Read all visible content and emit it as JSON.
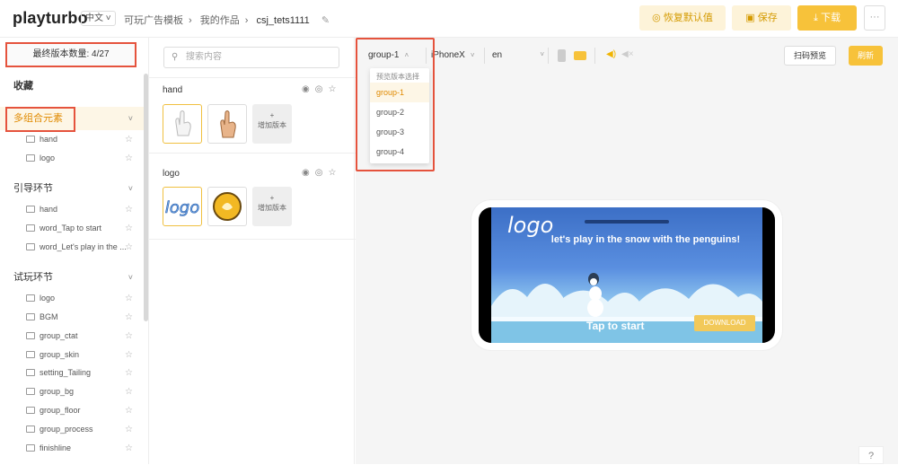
{
  "header": {
    "logo": "playturbo",
    "lang": "中文",
    "breadcrumb": [
      "可玩广告模板",
      "我的作品",
      "csj_tets1111"
    ],
    "restore_label": "恢复默认值",
    "save_label": "保存",
    "download_label": "下载",
    "more_label": "···"
  },
  "sidebar": {
    "version_count": "最终版本数量: 4/27",
    "favorites": "收藏",
    "sections": [
      {
        "title": "多组合元素",
        "items": [
          "hand",
          "logo"
        ]
      },
      {
        "title": "引导环节",
        "items": [
          "hand",
          "word_Tap to start",
          "word_Let's play in the ..."
        ]
      },
      {
        "title": "试玩环节",
        "items": [
          "logo",
          "BGM",
          "group_ctat",
          "group_skin",
          "setting_Tailing",
          "group_bg",
          "group_floor",
          "group_process",
          "finishline"
        ]
      }
    ]
  },
  "assets": {
    "search_placeholder": "搜索内容",
    "groups": [
      {
        "name": "hand",
        "add_label": "增加版本"
      },
      {
        "name": "logo",
        "add_label": "增加版本"
      }
    ]
  },
  "preview": {
    "group_select": "group-1",
    "device_select": "iPhoneX",
    "lang_select": "en",
    "scan_label": "扫码预览",
    "refresh_label": "刷新",
    "dropdown": {
      "header": "预览版本选择",
      "options": [
        "group-1",
        "group-2",
        "group-3",
        "group-4"
      ],
      "selected": "group-1"
    },
    "game": {
      "logo": "logo",
      "title": "let's play in the snow with the penguins!",
      "tap": "Tap to start",
      "download": "DOWNLOAD"
    }
  },
  "colors": {
    "accent": "#f7c23a",
    "highlight": "#e5533d",
    "active_text": "#e08a00"
  }
}
